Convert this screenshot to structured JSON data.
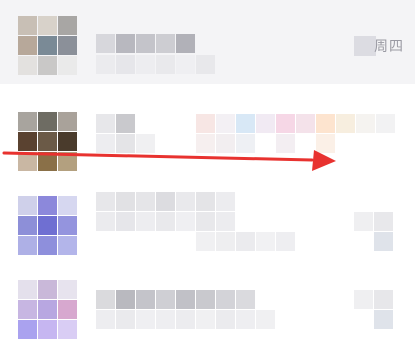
{
  "chat_list": {
    "rows": [
      {
        "id": "row-1",
        "pinned": true,
        "time": "周四"
      },
      {
        "id": "row-2",
        "pinned": false,
        "time": ""
      },
      {
        "id": "row-3",
        "pinned": false,
        "time": ""
      },
      {
        "id": "row-4",
        "pinned": false,
        "time": ""
      }
    ]
  },
  "annotation": {
    "arrow_color": "#e8322f",
    "direction": "right"
  },
  "colors": {
    "pinned_bg": "#f4f4f6",
    "row_bg": "#ffffff",
    "placeholder_text": "#c9c9cf"
  }
}
